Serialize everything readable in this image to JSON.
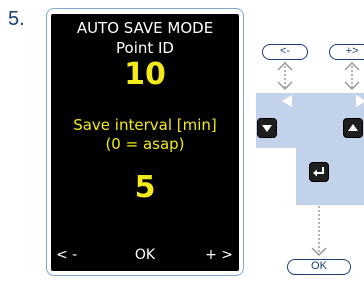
{
  "step": {
    "number": "5."
  },
  "screen": {
    "title": "AUTO SAVE MODE",
    "subtitle": "Point ID",
    "point_id_value": "10",
    "interval_label": "Save interval [min]",
    "interval_hint": "(0 = asap)",
    "interval_value": "5",
    "softkeys": {
      "left": "< -",
      "middle": "OK",
      "right": "+ >"
    }
  },
  "keypad": {
    "prev_label": "<-",
    "next_label": "+>",
    "ok_label": "OK",
    "keys": [
      "down-arrow-key",
      "up-arrow-key",
      "enter-key"
    ]
  },
  "colors": {
    "screen_bg": "#000000",
    "highlight": "#f4ea1a",
    "frame_border": "#7fa6d6",
    "panel": "#c2d2ea",
    "accent": "#1c3d78"
  }
}
